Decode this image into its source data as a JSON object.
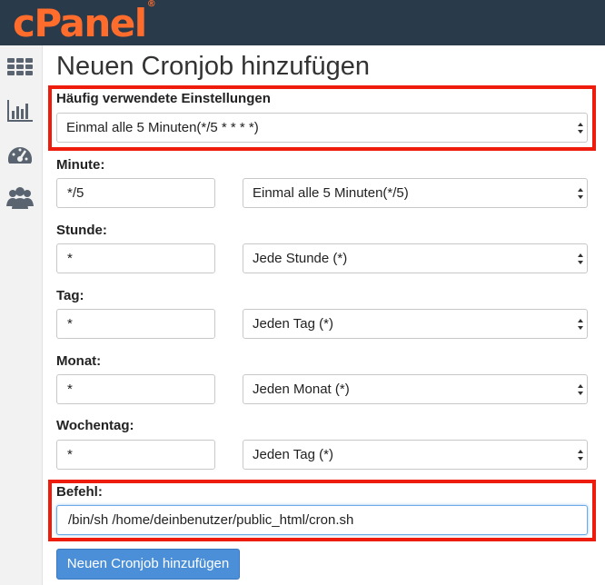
{
  "brand": {
    "logo_text": "cPanel",
    "trademark": "®",
    "logo_color": "#ff6c2c",
    "topbar_color": "#293a4a"
  },
  "sidebar": {
    "icons": [
      "grid-icon",
      "bar-chart-icon",
      "speedometer-icon",
      "users-icon"
    ]
  },
  "page": {
    "title": "Neuen Cronjob hinzufügen"
  },
  "form": {
    "common_settings": {
      "label": "Häufig verwendete Einstellungen",
      "selected": "Einmal alle 5 Minuten(*/5 * * * *)"
    },
    "fields": [
      {
        "label": "Minute:",
        "value": "*/5",
        "selected": "Einmal alle 5 Minuten(*/5)"
      },
      {
        "label": "Stunde:",
        "value": "*",
        "selected": "Jede Stunde (*)"
      },
      {
        "label": "Tag:",
        "value": "*",
        "selected": "Jeden Tag (*)"
      },
      {
        "label": "Monat:",
        "value": "*",
        "selected": "Jeden Monat (*)"
      },
      {
        "label": "Wochentag:",
        "value": "*",
        "selected": "Jeden Tag (*)"
      }
    ],
    "command": {
      "label": "Befehl:",
      "value": "/bin/sh /home/deinbenutzer/public_html/cron.sh"
    },
    "submit_label": "Neuen Cronjob hinzufügen"
  },
  "colors": {
    "highlight": "#ee1c0d",
    "primary_button": "#4b8fd9"
  }
}
